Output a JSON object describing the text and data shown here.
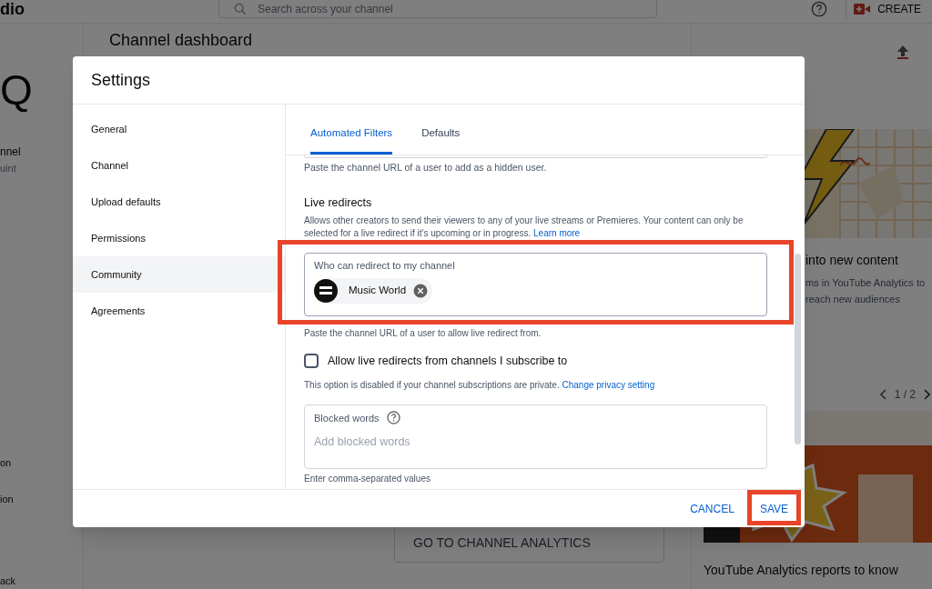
{
  "top_bar": {
    "logo_fragment": "dio",
    "search": {
      "placeholder": "Search across your channel"
    },
    "create_button": "CREATE"
  },
  "background": {
    "sidebar_fragments": [
      "Q",
      "nnel",
      "uint",
      "on",
      "ion",
      "ack"
    ],
    "page_title": "Channel dashboard",
    "analytics_button": "GO TO CHANNEL ANALYTICS",
    "card": {
      "title": "into new content",
      "body_lines": [
        "ms in YouTube Analytics to",
        "reach new audiences"
      ]
    },
    "pager": "1 / 2",
    "article_title": "YouTube Analytics reports to know"
  },
  "dialog": {
    "title": "Settings",
    "nav": [
      {
        "label": "General",
        "selected": false
      },
      {
        "label": "Channel",
        "selected": false
      },
      {
        "label": "Upload defaults",
        "selected": false
      },
      {
        "label": "Permissions",
        "selected": false
      },
      {
        "label": "Community",
        "selected": true
      },
      {
        "label": "Agreements",
        "selected": false
      }
    ],
    "tabs": [
      {
        "label": "Automated Filters",
        "selected": true
      },
      {
        "label": "Defaults",
        "selected": false
      }
    ],
    "hidden_user_hint": "Paste the channel URL of a user to add as a hidden user.",
    "section_title": "Live redirects",
    "section_description": "Allows other creators to send their viewers to any of your live streams or Premieres. Your content can only be selected for a live redirect if it's upcoming or in progress.",
    "section_link": "Learn more",
    "redirect_field": {
      "label": "Who can redirect to my channel",
      "chips": [
        {
          "name": "Music World"
        }
      ]
    },
    "redirect_hint": "Paste the channel URL of a user to allow live redirect from.",
    "subscribe_checkbox": {
      "label": "Allow live redirects from channels I subscribe to",
      "checked": false
    },
    "privacy_note": {
      "text": "This option is disabled if your channel subscriptions are private.",
      "link": "Change privacy setting"
    },
    "blocked_words": {
      "label": "Blocked words",
      "placeholder": "Add blocked words",
      "hint": "Enter comma-separated values"
    },
    "buttons": {
      "cancel": "CANCEL",
      "save": "SAVE"
    }
  }
}
